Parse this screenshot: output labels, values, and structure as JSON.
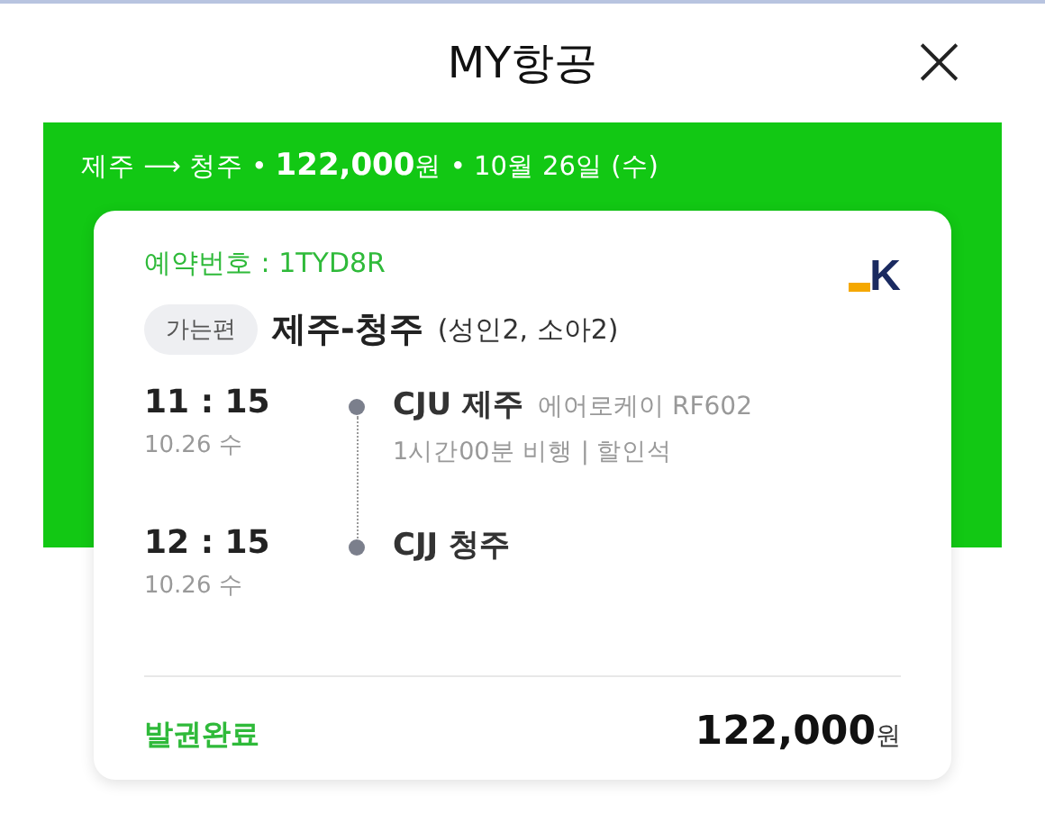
{
  "header": {
    "title": "MY항공",
    "close": "×"
  },
  "summary": "제주 ⟶ 청주 • **122,000**원 • 10월 26일 (수)",
  "booking": {
    "reservation": "예약번호 : 1TYD8R",
    "logo": "K",
    "direction_tag": "가는편",
    "route": "제주-청주",
    "passengers": "(성인2, 소아2)",
    "legs": [
      {
        "time": "11 : 15",
        "date": "10.26 수",
        "airport": "CJU 제주",
        "airline": "에어로케이 RF602",
        "detail": "1시간00분 비행 | 할인석"
      },
      {
        "time": "12 : 15",
        "date": "10.26 수",
        "airport": "CJJ 청주"
      }
    ],
    "status": "발권완료",
    "price": "122,000",
    "currency": "원"
  }
}
